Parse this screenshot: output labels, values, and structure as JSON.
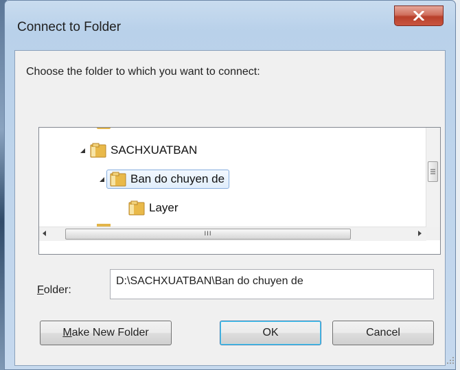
{
  "window": {
    "title": "Connect to Folder",
    "close_glyph": "X"
  },
  "prompt": "Choose the folder to which you want to connect:",
  "tree": {
    "items": [
      {
        "label": "SACHXUATBAN",
        "expanded": true,
        "selected": false
      },
      {
        "label": "Ban do chuyen de",
        "expanded": true,
        "selected": true
      },
      {
        "label": "Layer",
        "expanded": false,
        "selected": false
      }
    ],
    "hscroll_grip": "III"
  },
  "folder": {
    "label_accel": "F",
    "label_rest": "older:",
    "value": "D:\\SACHXUATBAN\\Ban do chuyen de"
  },
  "buttons": {
    "make_new_accel": "M",
    "make_new_rest": "ake New Folder",
    "ok": "OK",
    "cancel": "Cancel"
  },
  "colors": {
    "selection_border": "#84acdd",
    "close_red": "#c9553f",
    "ok_border": "#3c7fb1"
  }
}
